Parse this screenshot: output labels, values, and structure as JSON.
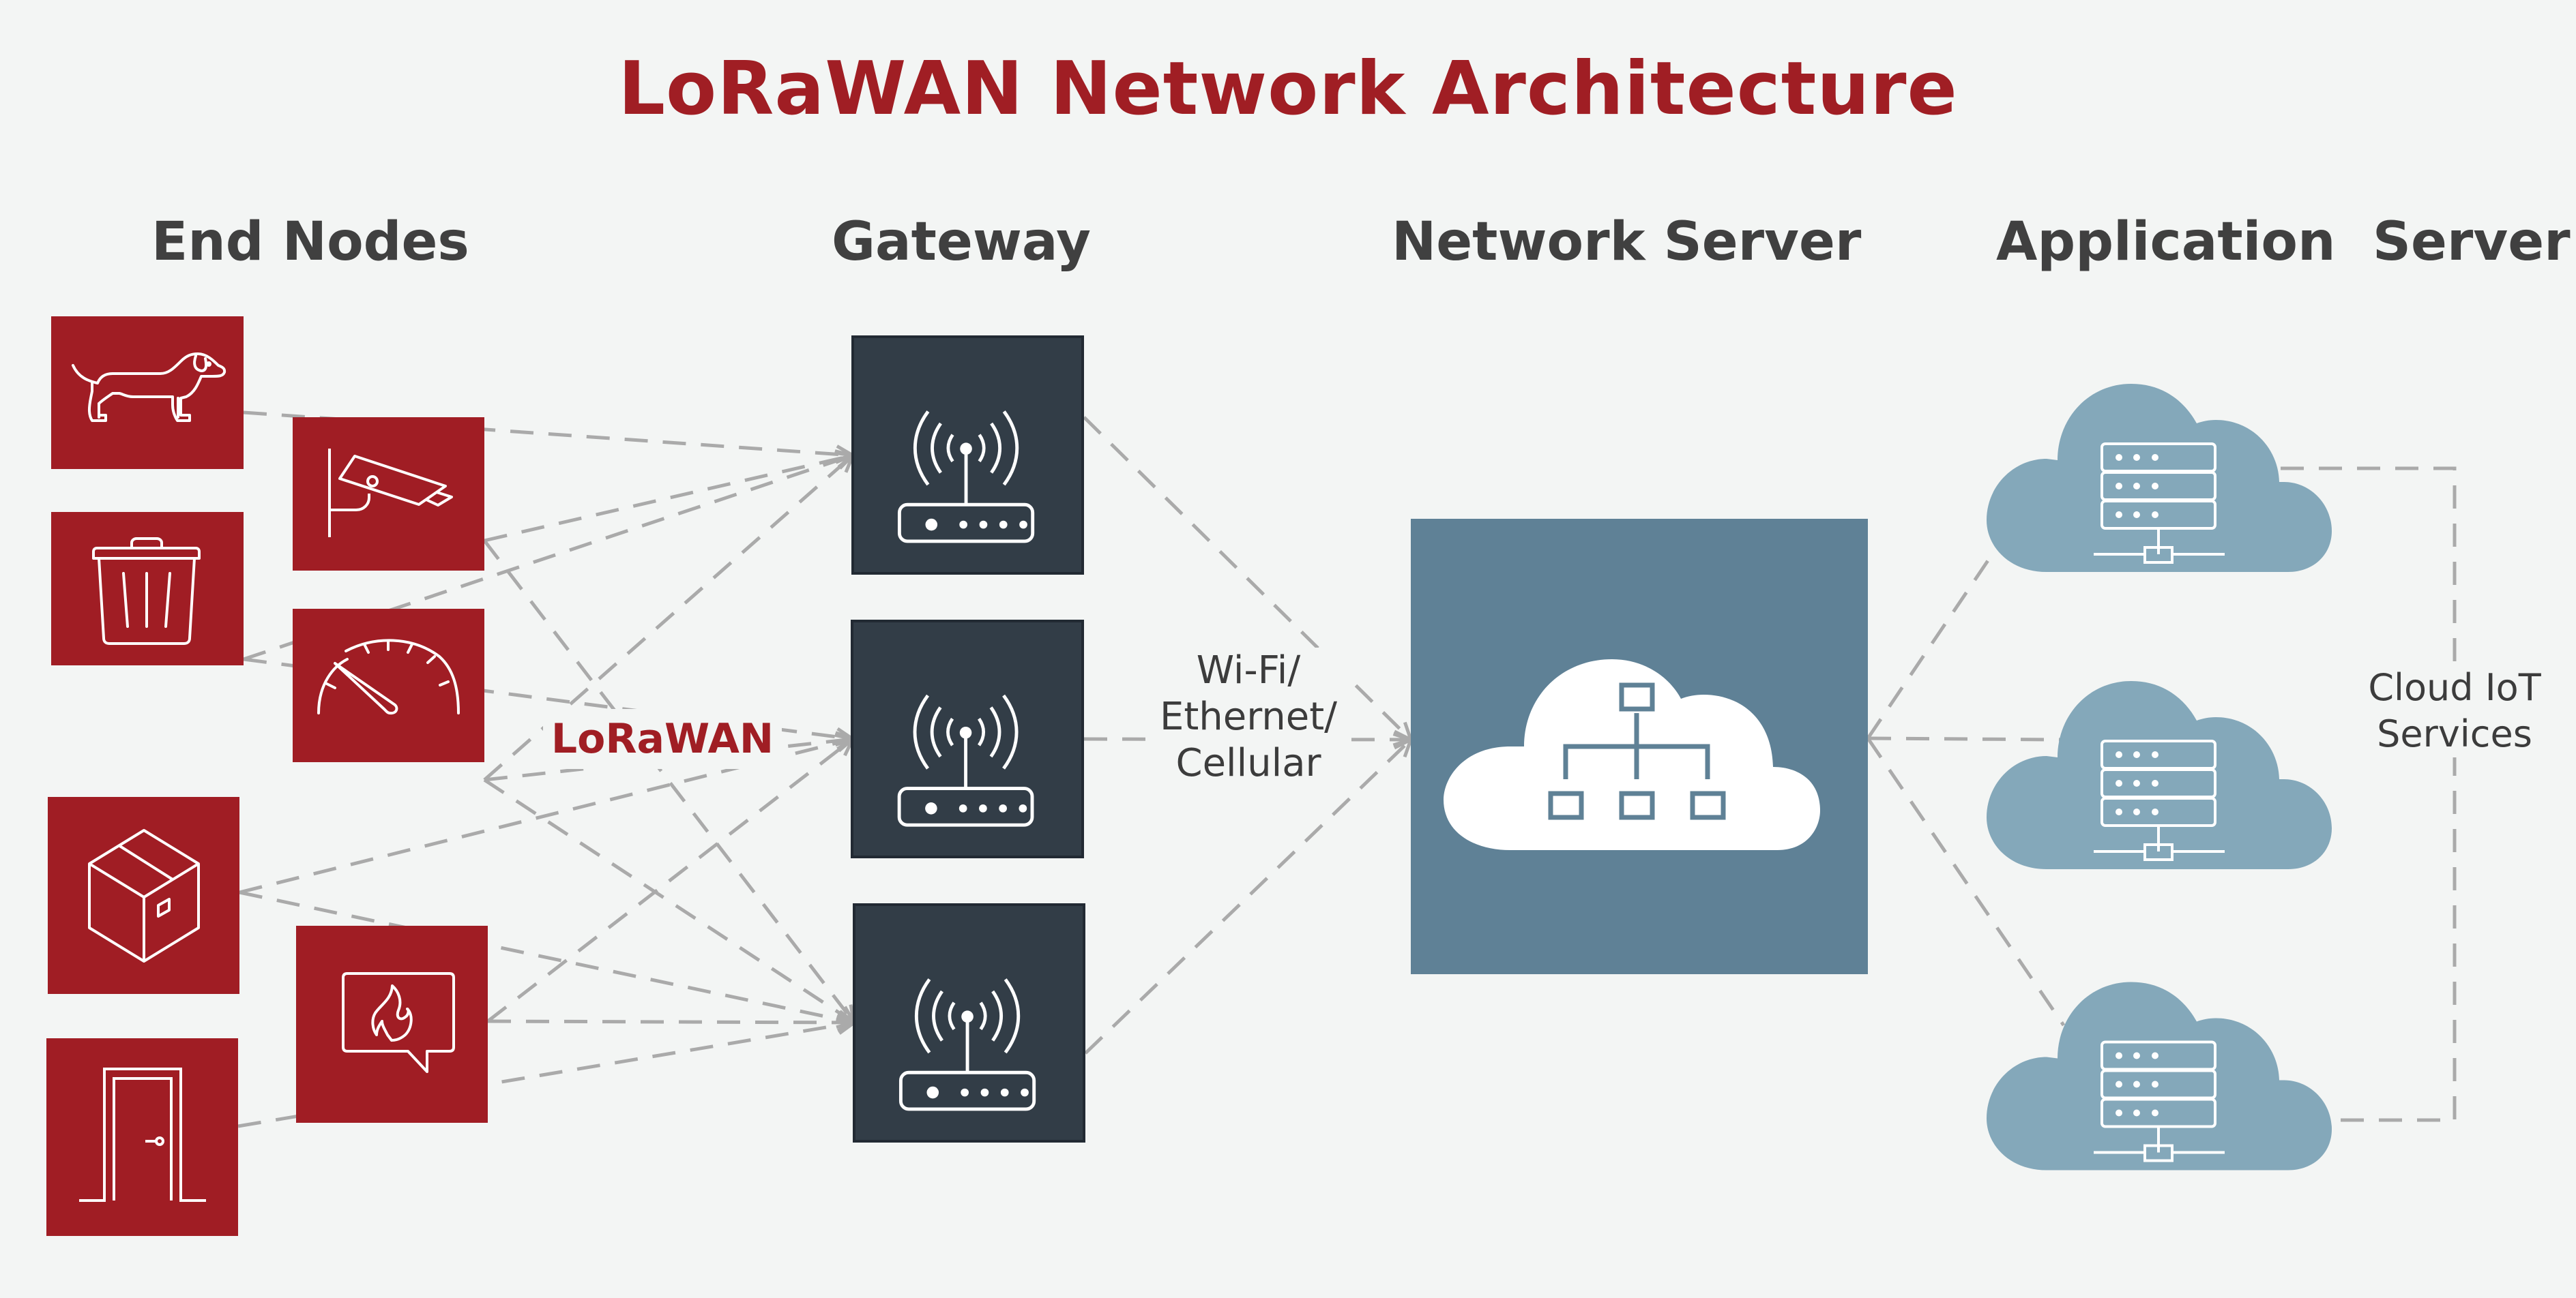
{
  "title": "LoRaWAN Network Architecture",
  "columns": {
    "end_nodes": "End Nodes",
    "gateway": "Gateway",
    "network_server": "Network Server",
    "application_server": "Application  Server"
  },
  "end_nodes": [
    {
      "id": "dog",
      "icon": "dog-icon",
      "label": "Pet tracker"
    },
    {
      "id": "camera",
      "icon": "security-camera-icon",
      "label": "Security camera"
    },
    {
      "id": "trash",
      "icon": "trash-bin-icon",
      "label": "Smart waste bin"
    },
    {
      "id": "gauge",
      "icon": "speedometer-icon",
      "label": "Meter / gauge"
    },
    {
      "id": "box",
      "icon": "package-icon",
      "label": "Asset / package tracker"
    },
    {
      "id": "fire",
      "icon": "fire-alarm-icon",
      "label": "Fire alarm"
    },
    {
      "id": "door",
      "icon": "door-icon",
      "label": "Door sensor"
    }
  ],
  "gateways": [
    {
      "id": "gw1",
      "icon": "router-antenna-icon"
    },
    {
      "id": "gw2",
      "icon": "router-antenna-icon"
    },
    {
      "id": "gw3",
      "icon": "router-antenna-icon"
    }
  ],
  "network_server": {
    "icon": "cloud-network-hierarchy-icon"
  },
  "application_servers": [
    {
      "id": "app1",
      "icon": "cloud-server-rack-icon"
    },
    {
      "id": "app2",
      "icon": "cloud-server-rack-icon"
    },
    {
      "id": "app3",
      "icon": "cloud-server-rack-icon"
    }
  ],
  "labels": {
    "lorawan": "LoRaWAN",
    "backhaul_lines": [
      "Wi-Fi/",
      "Ethernet/",
      "Cellular"
    ],
    "cloud_iot_lines": [
      "Cloud IoT",
      "Services"
    ]
  },
  "connections": {
    "end_to_gateway": [
      [
        "dog",
        "gw1"
      ],
      [
        "camera",
        "gw1"
      ],
      [
        "trash",
        "gw1"
      ],
      [
        "gauge",
        "gw1"
      ],
      [
        "trash",
        "gw2"
      ],
      [
        "camera",
        "gw3"
      ],
      [
        "gauge",
        "gw2"
      ],
      [
        "box",
        "gw2"
      ],
      [
        "fire",
        "gw2"
      ],
      [
        "box",
        "gw3"
      ],
      [
        "gauge",
        "gw3"
      ],
      [
        "fire",
        "gw3"
      ],
      [
        "door",
        "gw3"
      ]
    ],
    "gateway_to_network": [
      "gw1",
      "gw2",
      "gw3"
    ],
    "network_to_app": [
      "app1",
      "app2",
      "app3"
    ],
    "cloud_iot_bracket": [
      "app1",
      "app3"
    ]
  },
  "colors": {
    "brand_red": "#a01e24",
    "gateway_dark": "#323d47",
    "network_blue": "#5f8196",
    "cloud_blue": "#84a8ba",
    "connector_gray": "#aaaaaa",
    "background": "#f3f5f4",
    "text_dark": "#404040"
  }
}
